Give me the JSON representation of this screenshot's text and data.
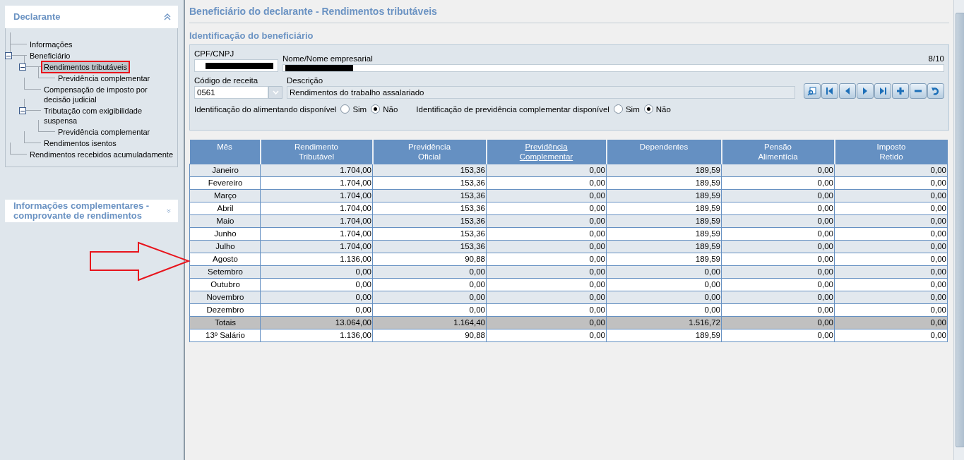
{
  "sidebar": {
    "panels": [
      {
        "title": "Declarante",
        "expanded": true,
        "tree": [
          {
            "label": "Informações",
            "selected": false
          },
          {
            "label": "Beneficiário",
            "selected": false,
            "expanded": true,
            "children": [
              {
                "label": "Rendimentos tributáveis",
                "selected": true,
                "expanded": true,
                "children": [
                  {
                    "label": "Previdência complementar",
                    "selected": false
                  }
                ]
              },
              {
                "label": "Compensação de imposto por decisão judicial",
                "selected": false
              },
              {
                "label": "Tributação com exigibilidade suspensa",
                "selected": false,
                "expanded": true,
                "children": [
                  {
                    "label": "Previdência complementar",
                    "selected": false
                  }
                ]
              },
              {
                "label": "Rendimentos isentos",
                "selected": false
              }
            ]
          },
          {
            "label": "Rendimentos recebidos acumuladamente",
            "selected": false
          }
        ]
      },
      {
        "title": "Informações complementares - comprovante de rendimentos",
        "expanded": false
      }
    ]
  },
  "page_title": "Beneficiário do declarante - Rendimentos tributáveis",
  "section_title": "Identificação do beneficiário",
  "form": {
    "counter": "8/10",
    "cpf": {
      "label": "CPF/CNPJ",
      "redacted": true
    },
    "nome": {
      "label": "Nome/Nome empresarial",
      "redacted": true
    },
    "codigo": {
      "label": "Código de receita",
      "value": "0561"
    },
    "descricao": {
      "label": "Descrição",
      "value": "Rendimentos do trabalho assalariado"
    },
    "radio_groups": [
      {
        "label": "Identificação do alimentando disponível",
        "options": [
          {
            "label": "Sim",
            "selected": false
          },
          {
            "label": "Não",
            "selected": true
          }
        ]
      },
      {
        "label": "Identificação de previdência complementar disponível",
        "options": [
          {
            "label": "Sim",
            "selected": false
          },
          {
            "label": "Não",
            "selected": true
          }
        ]
      }
    ],
    "nav_buttons": [
      {
        "kind": "search"
      },
      {
        "kind": "first"
      },
      {
        "kind": "previous"
      },
      {
        "kind": "next"
      },
      {
        "kind": "last"
      },
      {
        "kind": "add"
      },
      {
        "kind": "remove"
      },
      {
        "kind": "undo"
      }
    ]
  },
  "table": {
    "columns": [
      {
        "lines": [
          "Mês"
        ],
        "link": false
      },
      {
        "lines": [
          "Rendimento",
          "Tributável"
        ],
        "link": false
      },
      {
        "lines": [
          "Previdência",
          "Oficial"
        ],
        "link": false
      },
      {
        "lines": [
          "Previdência",
          "Complementar"
        ],
        "link": true
      },
      {
        "lines": [
          "Dependentes"
        ],
        "link": false
      },
      {
        "lines": [
          "Pensão",
          "Alimentícia"
        ],
        "link": false
      },
      {
        "lines": [
          "Imposto",
          "Retido"
        ],
        "link": false
      }
    ],
    "rows": [
      {
        "kind": "month",
        "cells": [
          "Janeiro",
          "1.704,00",
          "153,36",
          "0,00",
          "189,59",
          "0,00",
          "0,00"
        ]
      },
      {
        "kind": "month",
        "cells": [
          "Fevereiro",
          "1.704,00",
          "153,36",
          "0,00",
          "189,59",
          "0,00",
          "0,00"
        ]
      },
      {
        "kind": "month",
        "cells": [
          "Março",
          "1.704,00",
          "153,36",
          "0,00",
          "189,59",
          "0,00",
          "0,00"
        ]
      },
      {
        "kind": "month",
        "cells": [
          "Abril",
          "1.704,00",
          "153,36",
          "0,00",
          "189,59",
          "0,00",
          "0,00"
        ]
      },
      {
        "kind": "month",
        "cells": [
          "Maio",
          "1.704,00",
          "153,36",
          "0,00",
          "189,59",
          "0,00",
          "0,00"
        ]
      },
      {
        "kind": "month",
        "cells": [
          "Junho",
          "1.704,00",
          "153,36",
          "0,00",
          "189,59",
          "0,00",
          "0,00"
        ]
      },
      {
        "kind": "month",
        "cells": [
          "Julho",
          "1.704,00",
          "153,36",
          "0,00",
          "189,59",
          "0,00",
          "0,00"
        ]
      },
      {
        "kind": "month",
        "cells": [
          "Agosto",
          "1.136,00",
          "90,88",
          "0,00",
          "189,59",
          "0,00",
          "0,00"
        ]
      },
      {
        "kind": "month",
        "cells": [
          "Setembro",
          "0,00",
          "0,00",
          "0,00",
          "0,00",
          "0,00",
          "0,00"
        ]
      },
      {
        "kind": "month",
        "cells": [
          "Outubro",
          "0,00",
          "0,00",
          "0,00",
          "0,00",
          "0,00",
          "0,00"
        ]
      },
      {
        "kind": "month",
        "cells": [
          "Novembro",
          "0,00",
          "0,00",
          "0,00",
          "0,00",
          "0,00",
          "0,00"
        ]
      },
      {
        "kind": "month",
        "cells": [
          "Dezembro",
          "0,00",
          "0,00",
          "0,00",
          "0,00",
          "0,00",
          "0,00"
        ]
      },
      {
        "kind": "total",
        "cells": [
          "Totais",
          "13.064,00",
          "1.164,40",
          "0,00",
          "1.516,72",
          "0,00",
          "0,00"
        ]
      },
      {
        "kind": "extra",
        "cells": [
          "13º Salário",
          "1.136,00",
          "90,88",
          "0,00",
          "189,59",
          "0,00",
          "0,00"
        ]
      }
    ]
  }
}
